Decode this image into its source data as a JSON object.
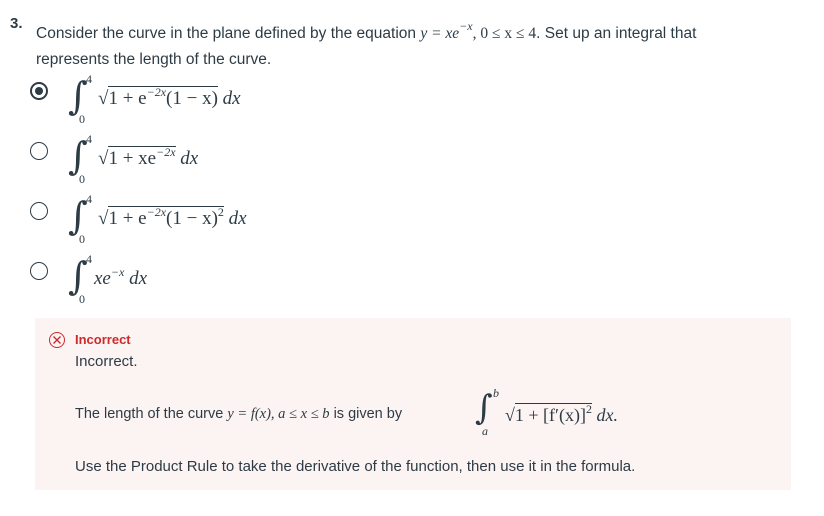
{
  "question": {
    "number": "3.",
    "text_before": "Consider the curve in the plane defined by the equation ",
    "equation": "y = xe",
    "equation_exp": "−x",
    "constraint": ", 0 ≤ x ≤ 4",
    "text_after": ". Set up an integral that",
    "text_line2": "represents the length of the curve."
  },
  "options": [
    {
      "selected": true,
      "upper": "4",
      "lower": "0",
      "parts": {
        "a": "1 + e",
        "exp": "−2x",
        "b": "(1 − x)",
        "dx": " dx"
      }
    },
    {
      "selected": false,
      "upper": "4",
      "lower": "0",
      "parts": {
        "a": "1 + xe",
        "exp": "−2x",
        "dx": " dx"
      }
    },
    {
      "selected": false,
      "upper": "4",
      "lower": "0",
      "parts": {
        "a": "1 + e",
        "exp": "−2x",
        "b": "(1 − x)",
        "exp2": "2",
        "dx": " dx"
      }
    },
    {
      "selected": false,
      "upper": "4",
      "lower": "0",
      "parts": {
        "a": "xe",
        "exp": "−x",
        "dx": " dx"
      }
    }
  ],
  "feedback": {
    "title": "Incorrect",
    "subtitle": "Incorrect.",
    "formula_lead_text": "The length of the curve ",
    "formula_lead_math": "y = f(x), a ≤ x ≤ b",
    "formula_lead_end": " is given by",
    "upper": "b",
    "lower": "a",
    "integrand": "1 + [f′(x)]",
    "integrand_exp": "2",
    "dx": " dx.",
    "hint": "Use the Product Rule to take the derivative of the function, then use it in the formula."
  },
  "colors": {
    "text": "#2d3b45",
    "error": "#d0292c",
    "feedback_bg": "#fcf3f3"
  }
}
